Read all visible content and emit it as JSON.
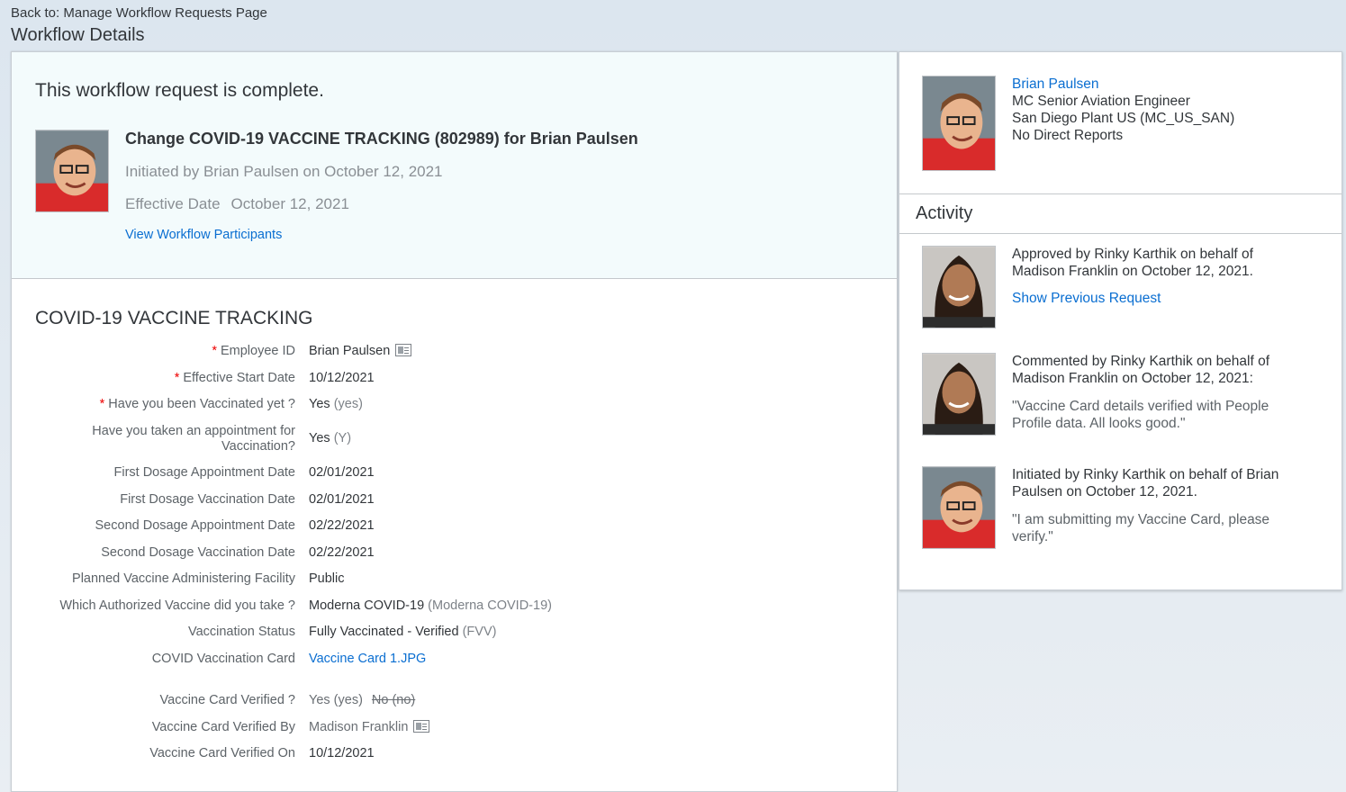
{
  "header": {
    "back_link": "Back to: Manage Workflow Requests Page",
    "title": "Workflow Details"
  },
  "summary": {
    "status_message": "This workflow request is complete.",
    "request_title": "Change COVID-19 VACCINE TRACKING (802989) for Brian Paulsen",
    "initiated_text": "Initiated by Brian Paulsen on October 12, 2021",
    "effective_label": "Effective Date",
    "effective_value": "October 12, 2021",
    "participants_link": "View Workflow Participants"
  },
  "form": {
    "title": "COVID-19 VACCINE TRACKING",
    "fields": [
      {
        "label": "Employee ID",
        "required": "*",
        "value": "Brian Paulsen",
        "code": ""
      },
      {
        "label": "Effective Start Date",
        "required": "*",
        "value": "10/12/2021",
        "code": ""
      },
      {
        "label": "Have you been Vaccinated yet ?",
        "required": "*",
        "value": "Yes",
        "code": "(yes)"
      },
      {
        "label": "Have you taken an appointment for Vaccination?",
        "required": "",
        "value": "Yes",
        "code": "(Y)"
      },
      {
        "label": "First Dosage Appointment Date",
        "required": "",
        "value": "02/01/2021",
        "code": ""
      },
      {
        "label": "First Dosage Vaccination Date",
        "required": "",
        "value": "02/01/2021",
        "code": ""
      },
      {
        "label": "Second Dosage Appointment Date",
        "required": "",
        "value": "02/22/2021",
        "code": ""
      },
      {
        "label": "Second Dosage Vaccination Date",
        "required": "",
        "value": "02/22/2021",
        "code": ""
      },
      {
        "label": "Planned Vaccine Administering Facility",
        "required": "",
        "value": "Public",
        "code": ""
      },
      {
        "label": "Which Authorized Vaccine did you take ?",
        "required": "",
        "value": "Moderna COVID-19",
        "code": "(Moderna COVID-19)"
      },
      {
        "label": "Vaccination Status",
        "required": "",
        "value": "Fully Vaccinated - Verified",
        "code": "(FVV)"
      },
      {
        "label": "COVID Vaccination Card",
        "required": "",
        "value": "Vaccine Card 1.JPG",
        "code": ""
      },
      {
        "label": "Vaccine Card Verified ?",
        "required": "",
        "value": "Yes (yes)",
        "code": "",
        "old_value": "No (no)"
      },
      {
        "label": "Vaccine Card Verified By",
        "required": "",
        "value": "Madison Franklin",
        "code": ""
      },
      {
        "label": "Vaccine Card Verified On",
        "required": "",
        "value": "10/12/2021",
        "code": ""
      }
    ]
  },
  "profile": {
    "name": "Brian Paulsen",
    "job_title": "MC Senior Aviation Engineer",
    "location": "San Diego Plant US (MC_US_SAN)",
    "reports": "No Direct Reports"
  },
  "activity": {
    "title": "Activity",
    "items": [
      {
        "text": "Approved by Rinky Karthik on behalf of Madison Franklin on October 12, 2021.",
        "link": "Show Previous Request",
        "quote": ""
      },
      {
        "text": "Commented by Rinky Karthik on behalf of Madison Franklin on October 12, 2021:",
        "link": "",
        "quote": "\"Vaccine Card details verified with People Profile data. All looks good.\""
      },
      {
        "text": "Initiated by Rinky Karthik on behalf of Brian Paulsen on October 12, 2021.",
        "link": "",
        "quote": "\"I am submitting my Vaccine Card, please verify.\""
      }
    ]
  },
  "colors": {
    "link": "#0a6ed1",
    "required": "#ee0000",
    "summary_bg": "#f3fbfc"
  }
}
